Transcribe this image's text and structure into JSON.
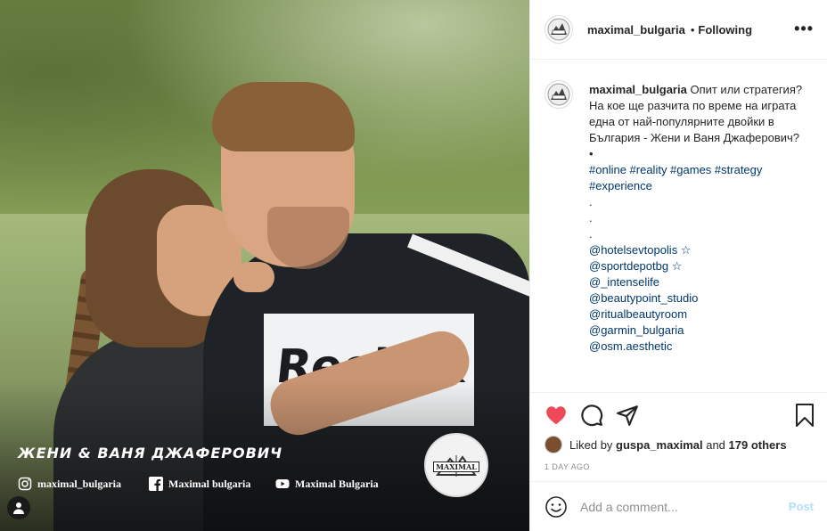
{
  "post": {
    "username": "maximal_bulgaria",
    "follow_dot": "•",
    "follow_status": "Following",
    "more_label": "•••"
  },
  "photo": {
    "shirt_brand": "Reebok",
    "overlay_title": "ЖЕНИ & ВАНЯ ДЖАФЕРОВИЧ",
    "logo_text": "MAXIMAL",
    "social": [
      {
        "icon": "instagram-icon",
        "label": "maximal_bulgaria"
      },
      {
        "icon": "facebook-icon",
        "label": "Maximal bulgaria"
      },
      {
        "icon": "youtube-icon",
        "label": "Maximal Bulgaria"
      }
    ]
  },
  "caption": {
    "username": "maximal_bulgaria",
    "lines": [
      "Опит или стратегия?",
      "На кое ще разчита по време на играта една от най-популярните двойки в България - Жени и Ваня Джаферович?",
      "•"
    ],
    "hashtags_1": "#online #reality #games #strategy",
    "hashtags_2": "#experience",
    "dots": [
      ".",
      ".",
      "."
    ],
    "mentions": [
      "@hotelsevtopolis ☆",
      "@sportdepotbg ☆",
      "@_intenselife",
      "@beautypoint_studio",
      "@ritualbeautyroom",
      "@garmin_bulgaria",
      "@osm.aesthetic"
    ]
  },
  "actions": {
    "liked_by_prefix": "Liked by",
    "liked_by_user": "guspa_maximal",
    "and_text": "and",
    "others": "179 others",
    "time": "1 DAY AGO"
  },
  "comment": {
    "placeholder": "Add a comment...",
    "post_label": "Post"
  },
  "colors": {
    "heart": "#ed4956",
    "link": "#00376b",
    "post_disabled": "#b2dffc"
  }
}
